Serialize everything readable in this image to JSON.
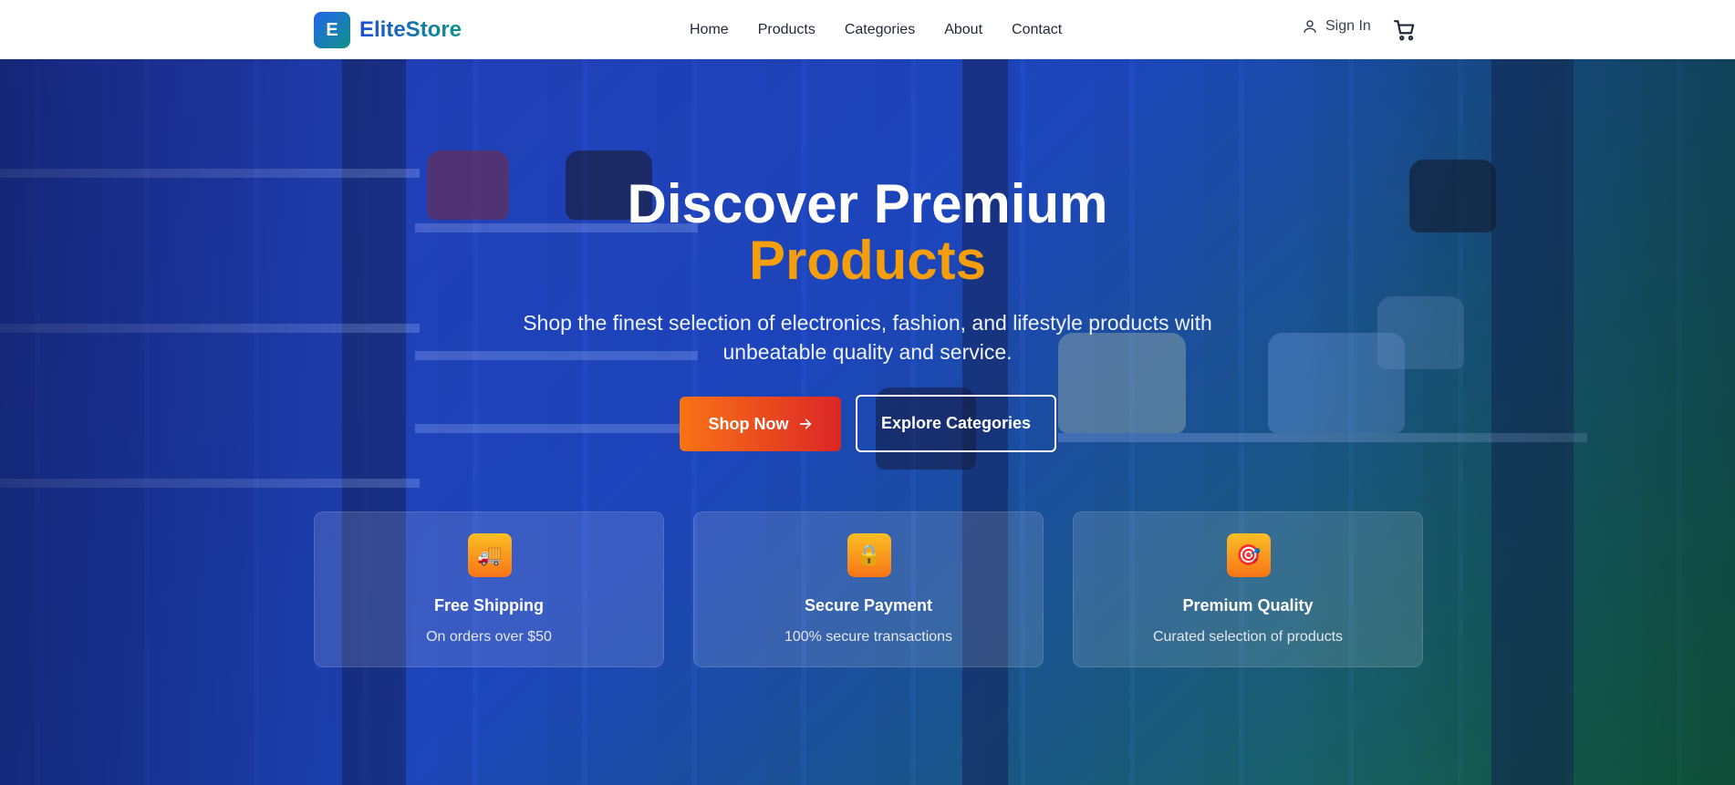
{
  "brand": {
    "badge": "E",
    "name": "EliteStore"
  },
  "nav": [
    "Home",
    "Products",
    "Categories",
    "About",
    "Contact"
  ],
  "account": {
    "signin_label": "Sign In"
  },
  "hero": {
    "title_line1": "Discover Premium",
    "title_line2": "Products",
    "subtitle": "Shop the finest selection of electronics, fashion, and lifestyle products with unbeatable quality and service.",
    "primary_cta": "Shop Now",
    "secondary_cta": "Explore Categories"
  },
  "features": [
    {
      "icon": "truck-icon",
      "glyph": "🚚",
      "title": "Free Shipping",
      "desc": "On orders over $50"
    },
    {
      "icon": "lock-icon",
      "glyph": "🔒",
      "title": "Secure Payment",
      "desc": "100% secure transactions"
    },
    {
      "icon": "target-icon",
      "glyph": "🎯",
      "title": "Premium Quality",
      "desc": "Curated selection of products"
    }
  ],
  "colors": {
    "accent": "#f59e0b",
    "primary_gradient_start": "#f97316",
    "primary_gradient_end": "#dc2626",
    "brand_blue": "#1d4ed8",
    "brand_teal": "#0d9488"
  }
}
